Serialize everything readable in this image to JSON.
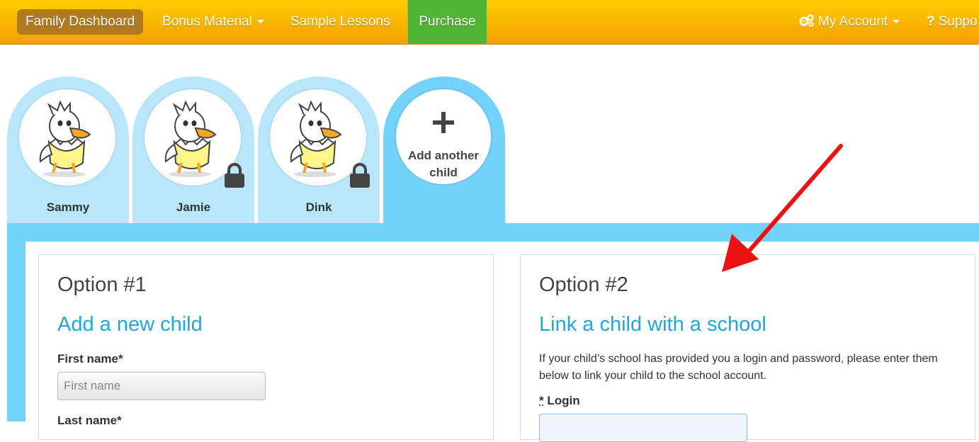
{
  "nav": {
    "dashboard": "Family Dashboard",
    "bonus": "Bonus Material",
    "samples": "Sample Lessons",
    "purchase": "Purchase",
    "account": "My Account",
    "support": "Suppo"
  },
  "children": [
    {
      "name": "Sammy",
      "locked": false
    },
    {
      "name": "Jamie",
      "locked": true
    },
    {
      "name": "Dink",
      "locked": true
    }
  ],
  "add_child": {
    "line1": "Add another",
    "line2": "child"
  },
  "option1": {
    "title": "Option #1",
    "subtitle": "Add a new child",
    "first_name_label": "First name*",
    "first_name_placeholder": "First name",
    "last_name_label": "Last name*"
  },
  "option2": {
    "title": "Option #2",
    "subtitle": "Link a child with a school",
    "description": "If your child’s school has provided you a login and password, please enter them below to link your child to the school account.",
    "login_req": "*",
    "login_label": "Login"
  },
  "colors": {
    "nav_orange": "#ffcc00",
    "purchase_green": "#52b435",
    "tab_light_blue": "#b9e6fb",
    "tab_active_blue": "#74d3fb",
    "heading_blue": "#1ba8e0",
    "arrow_red": "#ee1111"
  }
}
